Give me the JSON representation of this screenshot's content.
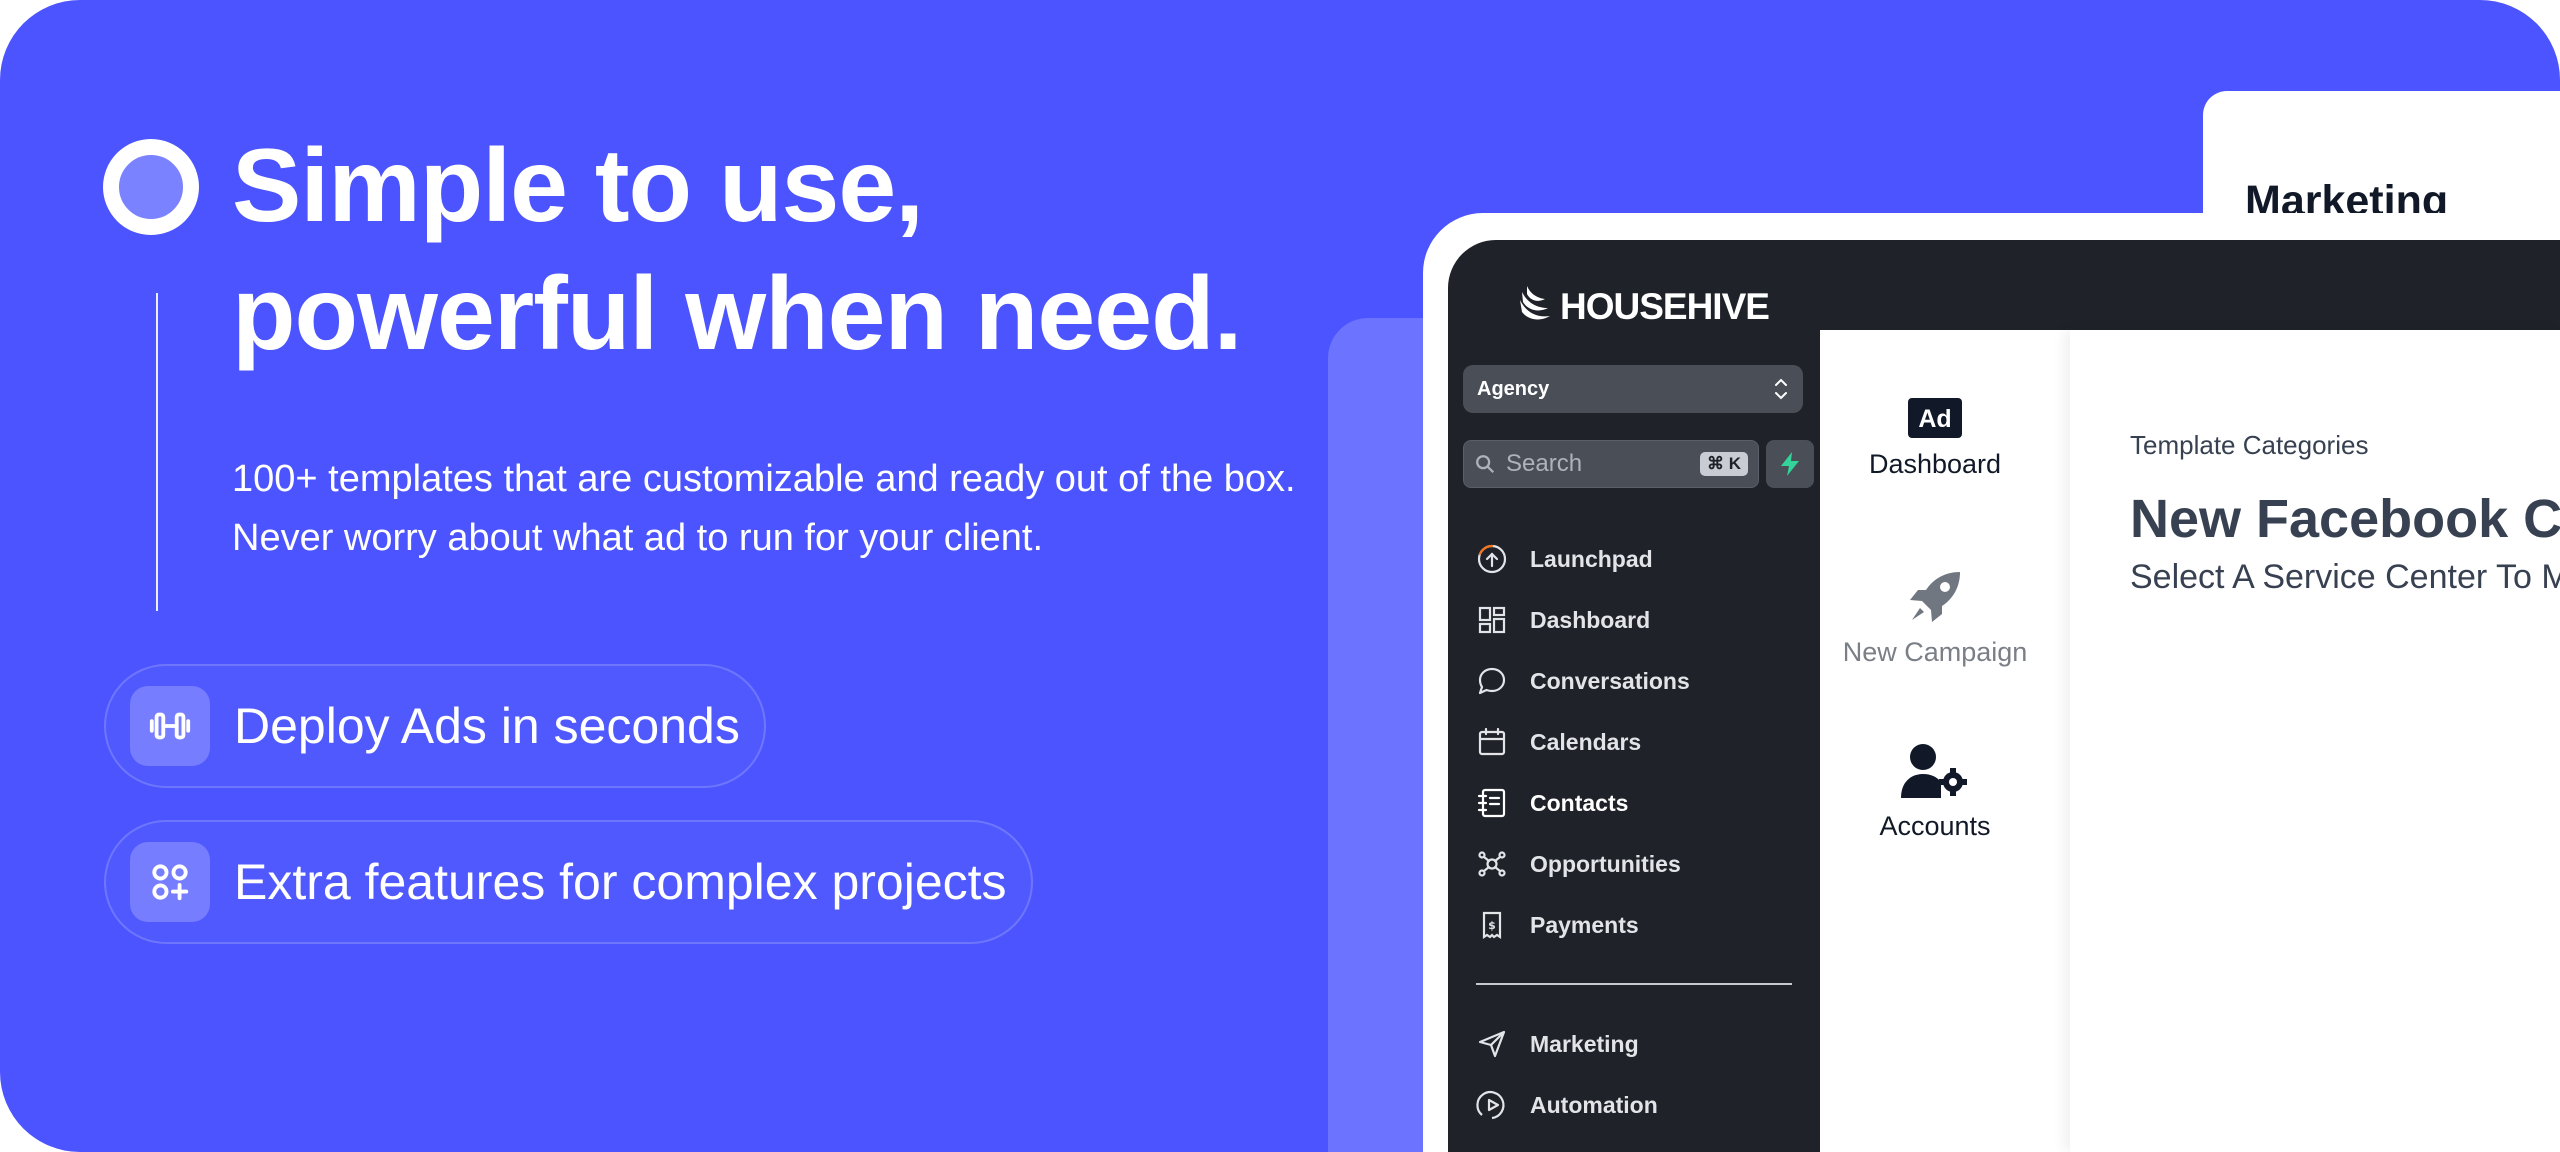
{
  "hero": {
    "headline_line1": "Simple to use,",
    "headline_line2": "powerful when need.",
    "description": "100+ templates that are  customizable and ready out of the box. Never worry about what ad to run for your client.",
    "features": [
      {
        "label": "Deploy Ads in seconds",
        "icon": "dumbbell-icon"
      },
      {
        "label": "Extra features for complex projects",
        "icon": "grid-plus-icon"
      }
    ],
    "colors": {
      "background": "#4b54fe",
      "accent_light": "#7b82ff"
    }
  },
  "marketing_card": {
    "title": "Marketing"
  },
  "app": {
    "brand": "HOUSEHIVE",
    "account_selector": "Agency",
    "search": {
      "placeholder": "Search",
      "shortcut": "⌘ K"
    },
    "nav": [
      {
        "label": "Launchpad",
        "icon": "launchpad-icon"
      },
      {
        "label": "Dashboard",
        "icon": "dashboard-grid-icon"
      },
      {
        "label": "Conversations",
        "icon": "chat-bubble-icon"
      },
      {
        "label": "Calendars",
        "icon": "calendar-icon"
      },
      {
        "label": "Contacts",
        "icon": "contacts-book-icon",
        "active": true
      },
      {
        "label": "Opportunities",
        "icon": "opportunities-icon"
      },
      {
        "label": "Payments",
        "icon": "payments-icon"
      }
    ],
    "nav_secondary": [
      {
        "label": "Marketing",
        "icon": "send-icon"
      },
      {
        "label": "Automation",
        "icon": "automation-icon"
      }
    ],
    "tiles": [
      {
        "label": "Dashboard",
        "icon": "ad-icon",
        "icon_text": "Ad"
      },
      {
        "label": "New Campaign",
        "icon": "rocket-icon"
      },
      {
        "label": "Accounts",
        "icon": "user-gear-icon"
      }
    ],
    "content": {
      "template_categories": "Template Categories",
      "heading": "New Facebook Ca",
      "subheading": "Select A Service Center To M"
    },
    "colors": {
      "sidebar": "#1f2229",
      "quick_action": "#34d399"
    }
  }
}
